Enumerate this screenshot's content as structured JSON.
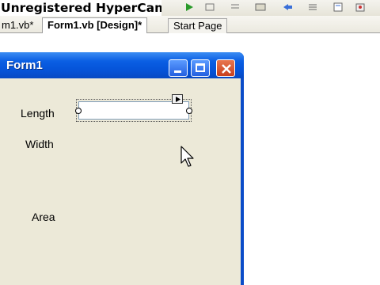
{
  "watermark": {
    "text": "Unregistered HyperCam"
  },
  "tabs": [
    {
      "label": "m1.vb*",
      "active": false
    },
    {
      "label": "Form1.vb [Design]*",
      "active": true
    },
    {
      "label": "Start Page",
      "active": false
    }
  ],
  "form": {
    "title": "Form1",
    "labels": {
      "length": "Length",
      "width": "Width",
      "area": "Area"
    },
    "length_input": {
      "value": ""
    }
  },
  "toolbar_icons": [
    "run-icon",
    "toolbar-icon",
    "toolbar-icon",
    "toolbar-icon",
    "toolbar-icon",
    "toolbar-icon",
    "toolbar-icon"
  ],
  "colors": {
    "titlebar": "#0553d8",
    "client_bg": "#ece9d8",
    "close_button": "#c8401e"
  }
}
